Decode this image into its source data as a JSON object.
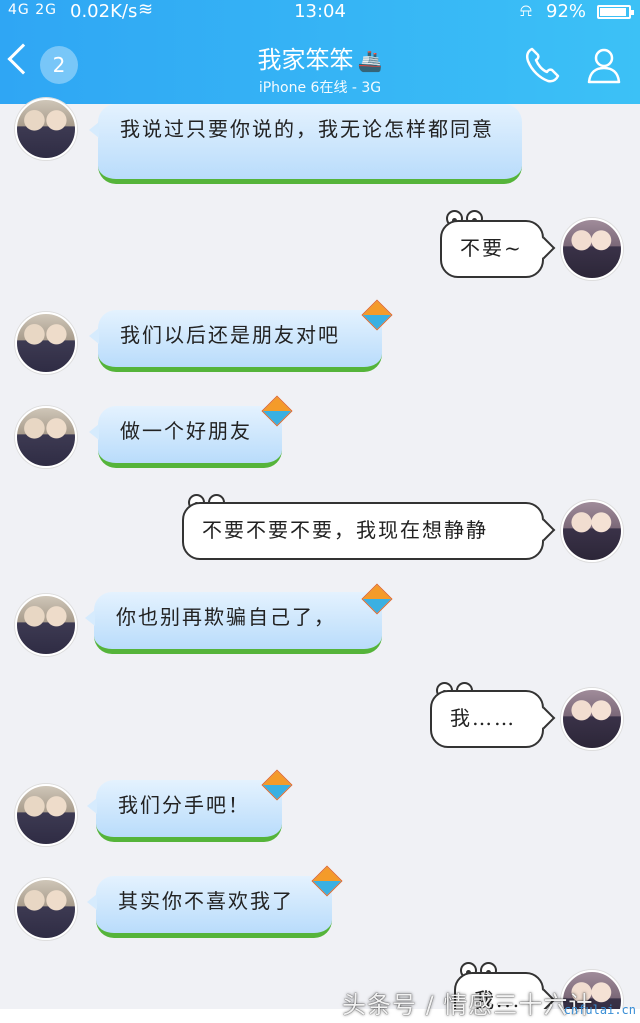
{
  "status_bar": {
    "signal": "4G 2G",
    "speed": "0.02K/s",
    "time": "13:04",
    "battery": "92%",
    "battery_level": 0.92
  },
  "header": {
    "back_badge": "2",
    "title": "我家笨笨",
    "subtitle": "iPhone 6在线 - 3G"
  },
  "messages": [
    {
      "side": "in",
      "text": "我说过只要你说的，我无论怎样都同意"
    },
    {
      "side": "out",
      "text": "不要~"
    },
    {
      "side": "in",
      "text": "我们以后还是朋友对吧"
    },
    {
      "side": "in",
      "text": "做一个好朋友"
    },
    {
      "side": "out",
      "text": "不要不要不要，我现在想静静"
    },
    {
      "side": "in",
      "text": "你也别再欺骗自己了，"
    },
    {
      "side": "out",
      "text": "我……"
    },
    {
      "side": "in",
      "text": "我们分手吧！"
    },
    {
      "side": "in",
      "text": "其实你不喜欢我了"
    },
    {
      "side": "out",
      "text": "我..."
    }
  ],
  "watermark": "头条号 / 情感三十六计",
  "corner_url": "cnfulai.cn",
  "colors": {
    "header": "#2fa6f4",
    "bubble_in": "#b9dcfb",
    "grass": "#55b43a"
  }
}
